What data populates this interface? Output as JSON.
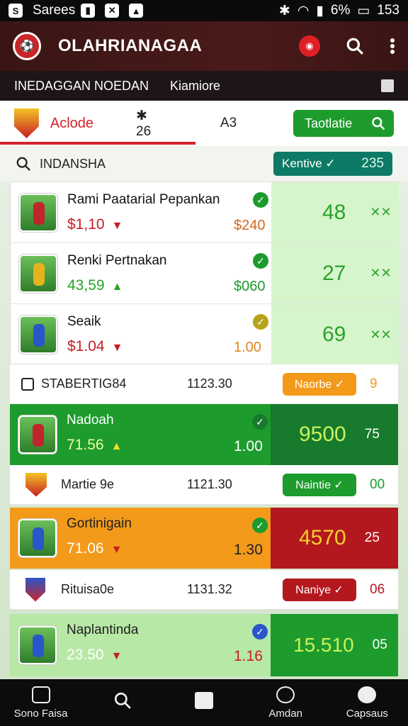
{
  "status": {
    "left": [
      "Sarees"
    ],
    "right": "153",
    "battery": "6%"
  },
  "app": {
    "title": "OLAHRIANAGAA"
  },
  "subbar": {
    "left": "INEDAGGAN NOEDAN",
    "right": "Kiamiore"
  },
  "tabs": {
    "active": "Aclode",
    "t2": "✱ 26",
    "t3": "A3",
    "button": "Taotlatie"
  },
  "search": {
    "label": "INDANSHA",
    "pill": "Kentive ✓",
    "pill_value": "235"
  },
  "players": [
    {
      "name": "Rami Paatarial Pepankan",
      "price": "$1,10",
      "odds": "$240",
      "score": "48",
      "x": "✕✕"
    },
    {
      "name": "Renki Pertnakan",
      "price": "43,59",
      "odds": "$060",
      "score": "27",
      "x": "✕✕"
    },
    {
      "name": "Seaik",
      "price": "$1.04",
      "odds": "1.00",
      "score": "69",
      "x": "✕✕"
    }
  ],
  "rows": [
    {
      "name": "STABERTIG84",
      "value": "1123.30",
      "btn": "Naorbe ✓",
      "num": "9"
    },
    {
      "name": "Martie 9e",
      "value": "1121.30",
      "btn": "Naintie ✓",
      "num": "00"
    },
    {
      "name": "Rituisa0e",
      "value": "1131.32",
      "btn": "Naniye ✓",
      "num": "06"
    }
  ],
  "big": [
    {
      "name": "Nadoah",
      "price": "71.56",
      "odds": "1.00",
      "score": "9500",
      "num": "75"
    },
    {
      "name": "Gortinigain",
      "price": "71.06",
      "odds": "1.30",
      "score": "4570",
      "num": "25"
    },
    {
      "name": "Naplantinda",
      "price": "23.50",
      "odds": "1.16",
      "score": "15.510",
      "num": "05"
    }
  ],
  "nav": [
    "Sono Faisa",
    "",
    "",
    "Amdan",
    "Capsaus"
  ],
  "colors": {
    "green": "#1d9b2d",
    "dark_green": "#177a2c",
    "orange": "#f39a1b",
    "red": "#b3181e",
    "teal": "#0d7a66"
  }
}
